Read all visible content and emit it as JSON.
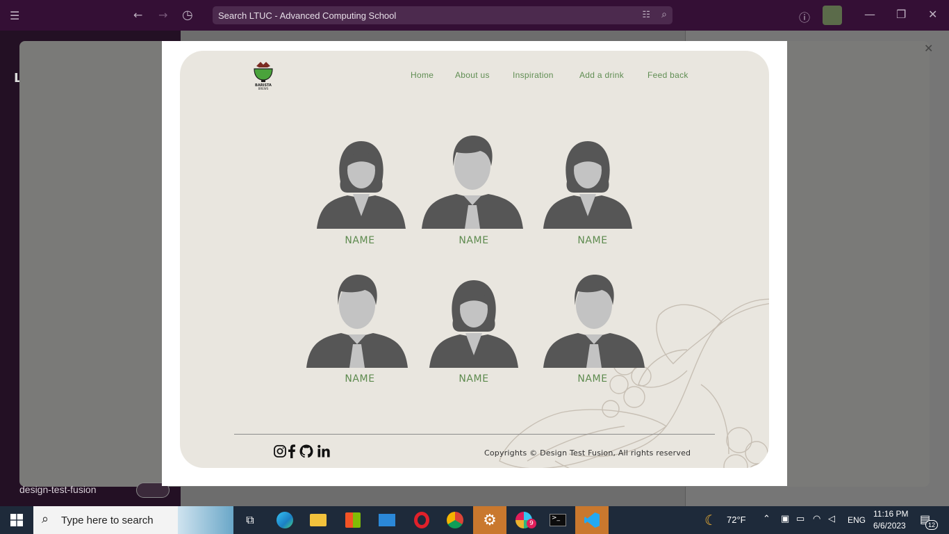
{
  "titlebar": {
    "search_placeholder": "Search LTUC - Advanced Computing School"
  },
  "sidebar": {
    "workspace_initial": "L",
    "workspace_name": "design-test-fusion"
  },
  "preview": {
    "logo_text": "BARISTA BREWS",
    "nav": [
      "Home",
      "About us",
      "Inspiration",
      "Add a drink",
      "Feed back"
    ],
    "team": [
      {
        "name": "NAME",
        "avatar": "female-avatar"
      },
      {
        "name": "NAME",
        "avatar": "male-avatar"
      },
      {
        "name": "NAME",
        "avatar": "female-avatar"
      },
      {
        "name": "NAME",
        "avatar": "male-avatar"
      },
      {
        "name": "NAME",
        "avatar": "female-avatar"
      },
      {
        "name": "NAME",
        "avatar": "male-avatar"
      }
    ],
    "social_icons": [
      "instagram-icon",
      "facebook-icon",
      "github-icon",
      "linkedin-icon"
    ],
    "copyright": "Copyrights © Design Test Fusion, All rights reserved",
    "colors": {
      "card_bg": "#e9e6df",
      "accent_green": "#5f8d52",
      "avatar_dark": "#565656",
      "avatar_face": "#c3c3c3"
    }
  },
  "taskbar": {
    "search_placeholder": "Type here to search",
    "weather": "72°F",
    "language": "ENG",
    "time": "11:16 PM",
    "date": "6/6/2023",
    "notifications": "12",
    "slack_badge": "9",
    "colors": {
      "active_app": "#c9782e"
    }
  }
}
